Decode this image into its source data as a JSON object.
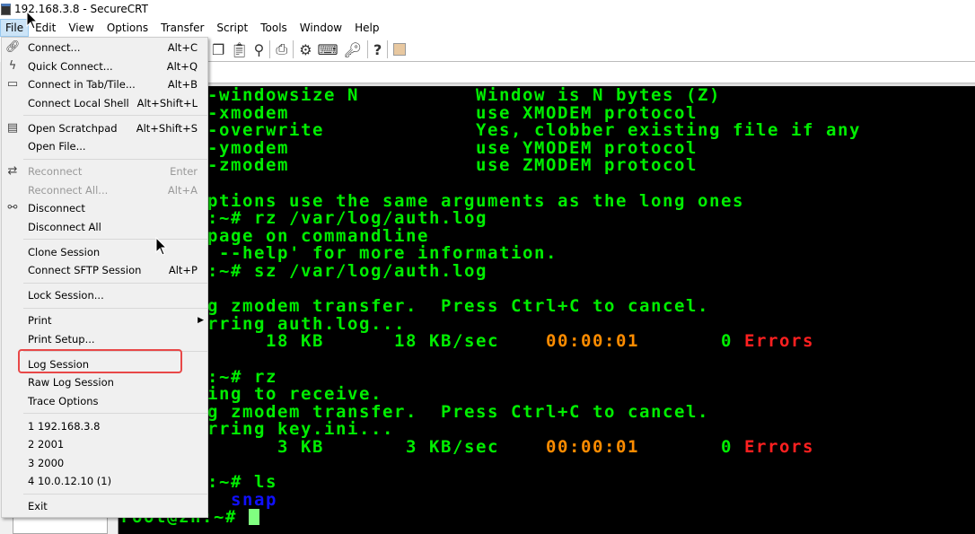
{
  "window": {
    "title": "192.168.3.8 - SecureCRT"
  },
  "menubar": [
    "File",
    "Edit",
    "View",
    "Options",
    "Transfer",
    "Script",
    "Tools",
    "Window",
    "Help"
  ],
  "toolbar_icons": [
    "copy-icon",
    "paste-icon",
    "find-icon",
    "print-icon",
    "settings-icon",
    "keymap-icon",
    "key-icon",
    "help-icon",
    "sftp-icon"
  ],
  "file_menu": [
    {
      "label": "Connect...",
      "shortcut": "Alt+C",
      "icon": "link-icon"
    },
    {
      "label": "Quick Connect...",
      "shortcut": "Alt+Q",
      "icon": "lightning-icon"
    },
    {
      "label": "Connect in Tab/Tile...",
      "shortcut": "Alt+B",
      "icon": "tab-icon"
    },
    {
      "label": "Connect Local Shell",
      "shortcut": "Alt+Shift+L"
    },
    {
      "sep": true
    },
    {
      "label": "Open Scratchpad",
      "shortcut": "Alt+Shift+S",
      "icon": "notepad-icon"
    },
    {
      "label": "Open File..."
    },
    {
      "sep": true
    },
    {
      "label": "Reconnect",
      "shortcut": "Enter",
      "icon": "reconnect-icon",
      "disabled": true
    },
    {
      "label": "Reconnect All...",
      "shortcut": "Alt+A",
      "disabled": true
    },
    {
      "label": "Disconnect",
      "icon": "broken-link-icon"
    },
    {
      "label": "Disconnect All"
    },
    {
      "sep": true
    },
    {
      "label": "Clone Session"
    },
    {
      "label": "Connect SFTP Session",
      "shortcut": "Alt+P"
    },
    {
      "sep": true
    },
    {
      "label": "Lock Session..."
    },
    {
      "sep": true
    },
    {
      "label": "Print",
      "submenu": true
    },
    {
      "label": "Print Setup..."
    },
    {
      "sep": true
    },
    {
      "label": "Log Session",
      "highlighted": true
    },
    {
      "label": "Raw Log Session"
    },
    {
      "label": "Trace Options"
    },
    {
      "sep": true
    },
    {
      "label": "1 192.168.3.8"
    },
    {
      "label": "2 2001"
    },
    {
      "label": "3 2000"
    },
    {
      "label": "4 10.0.12.10 (1)"
    },
    {
      "sep": true
    },
    {
      "label": "Exit"
    }
  ],
  "colors": {
    "terminal_fg": "#00ee00",
    "terminal_bg": "#000000",
    "time": "#ff8c00",
    "errors": "#ff2020",
    "dir": "#1010ff",
    "highlight_box": "#e84848"
  },
  "terminal_lines": [
    [
      {
        "t": "-windowsize N          Window is N bytes (Z)"
      }
    ],
    [
      {
        "t": "-xmodem                use XMODEM protocol"
      }
    ],
    [
      {
        "t": "-overwrite             Yes, clobber existing file if any"
      }
    ],
    [
      {
        "t": "-ymodem                use YMODEM protocol"
      }
    ],
    [
      {
        "t": "-zmodem                use ZMODEM protocol"
      }
    ],
    [],
    [
      {
        "t": "ptions use the same arguments as the long ones"
      }
    ],
    [
      {
        "t": ":~# rz /var/log/auth.log"
      }
    ],
    [
      {
        "t": "page on commandline"
      }
    ],
    [
      {
        "t": " --help' for more information."
      }
    ],
    [
      {
        "t": ":~# sz /var/log/auth.log"
      }
    ],
    [],
    [
      {
        "t": "g zmodem transfer.  Press Ctrl+C to cancel."
      }
    ],
    [
      {
        "t": "rring auth.log..."
      }
    ],
    [
      {
        "t": "     18 KB      18 KB/sec    "
      },
      {
        "t": "00:00:01",
        "c": "org"
      },
      {
        "t": "       0 "
      },
      {
        "t": "Errors",
        "c": "red"
      }
    ],
    [],
    [
      {
        "t": ":~# rz"
      }
    ],
    [
      {
        "t": "ing to receive."
      }
    ],
    [
      {
        "t": "g zmodem transfer.  Press Ctrl+C to cancel."
      }
    ],
    [
      {
        "t": "rring key.ini..."
      }
    ],
    [
      {
        "t": "      3 KB       3 KB/sec    "
      },
      {
        "t": "00:00:01",
        "c": "org"
      },
      {
        "t": "       0 "
      },
      {
        "t": "Errors",
        "c": "red"
      }
    ],
    [],
    [
      {
        "t": ":~# ls"
      }
    ],
    [
      {
        "t": "  "
      },
      {
        "t": "snap",
        "c": "blue"
      }
    ]
  ],
  "prompt": "root@zh:~# "
}
